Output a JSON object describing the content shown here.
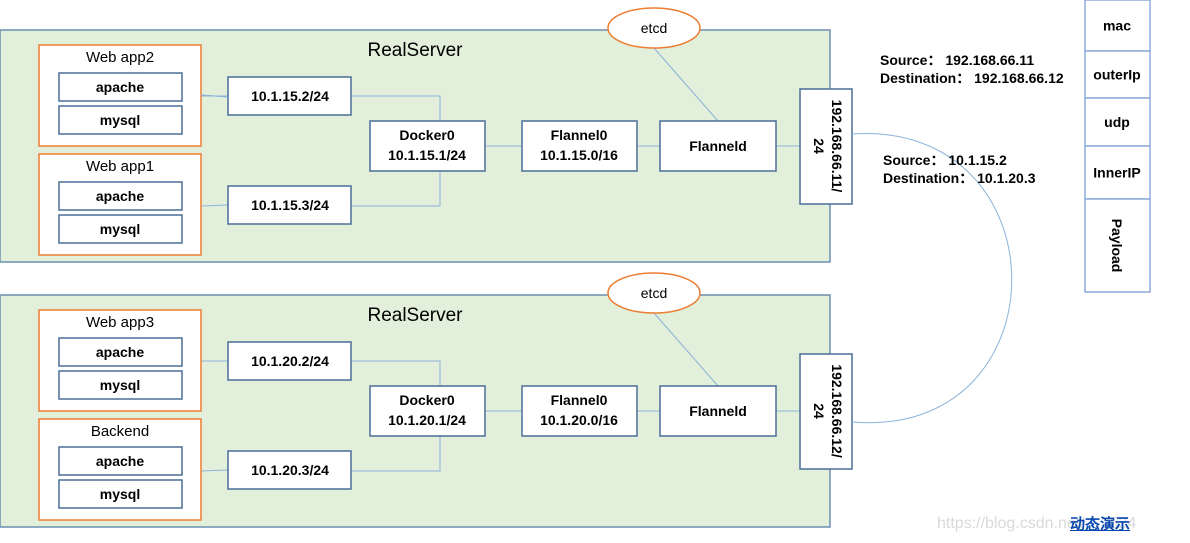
{
  "servers": [
    {
      "title": "RealServer",
      "etcd": "etcd",
      "apps": [
        {
          "name": "Web app2",
          "items": [
            "apache",
            "mysql"
          ]
        },
        {
          "name": "Web app1",
          "items": [
            "apache",
            "mysql"
          ]
        }
      ],
      "veth": [
        "10.1.15.2/24",
        "10.1.15.3/24"
      ],
      "docker": [
        "Docker0",
        "10.1.15.1/24"
      ],
      "flannel0": [
        "Flannel0",
        "10.1.15.0/16"
      ],
      "flanneld": "Flanneld",
      "iface": [
        "192.168.66.11/",
        "24"
      ]
    },
    {
      "title": "RealServer",
      "etcd": "etcd",
      "apps": [
        {
          "name": "Web app3",
          "items": [
            "apache",
            "mysql"
          ]
        },
        {
          "name": "Backend",
          "items": [
            "apache",
            "mysql"
          ]
        }
      ],
      "veth": [
        "10.1.20.2/24",
        "10.1.20.3/24"
      ],
      "docker": [
        "Docker0",
        "10.1.20.1/24"
      ],
      "flannel0": [
        "Flannel0",
        "10.1.20.0/16"
      ],
      "flanneld": "Flanneld",
      "iface": [
        "192.168.66.12/",
        "24"
      ]
    }
  ],
  "outer": {
    "source": "Source：  192.168.66.11",
    "destination": "Destination：  192.168.66.12"
  },
  "inner": {
    "source": "Source：  10.1.15.2",
    "destination": "Destination：  10.1.20.3"
  },
  "packet": [
    "mac",
    "outerIp",
    "udp",
    "InnerIP",
    "Payload"
  ],
  "link": "动态演示",
  "watermark": "https://blog.csdn.net/…2524",
  "colors": {
    "server_fill": "#e2efda",
    "app_border": "#ed7d31",
    "link": "#0645ad"
  }
}
